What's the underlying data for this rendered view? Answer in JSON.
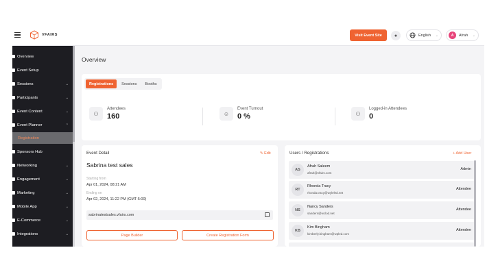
{
  "topbar": {
    "logo_text": "VFAIRS",
    "visit_button": "Visit Event Site",
    "language": "English",
    "user_initial": "A",
    "user_name": "Afrah"
  },
  "sidebar": {
    "items": [
      {
        "label": "Overview",
        "chevron": false
      },
      {
        "label": "Event Setup",
        "chevron": false
      },
      {
        "label": "Sessions",
        "chevron": true
      },
      {
        "label": "Participants",
        "chevron": true
      },
      {
        "label": "Event Content",
        "chevron": true
      },
      {
        "label": "Event Planner",
        "chevron": true
      },
      {
        "label": "Registration",
        "chevron": false,
        "active": true
      },
      {
        "label": "Sponsors Hub",
        "chevron": false
      },
      {
        "label": "Networking",
        "chevron": true
      },
      {
        "label": "Engagement",
        "chevron": true
      },
      {
        "label": "Marketing",
        "chevron": true
      },
      {
        "label": "Mobile App",
        "chevron": true
      },
      {
        "label": "E-Commerce",
        "chevron": true
      },
      {
        "label": "Integrations",
        "chevron": true
      }
    ]
  },
  "main": {
    "title": "Overview",
    "tabs": [
      "Registrations",
      "Sessions",
      "Booths"
    ],
    "stats": [
      {
        "label": "Attendees",
        "value": "160",
        "icon": "users-icon"
      },
      {
        "label": "Event Turnout",
        "value": "0 %",
        "icon": "user-icon"
      },
      {
        "label": "Logged-in Attendees",
        "value": "0",
        "icon": "users-icon"
      }
    ]
  },
  "event_detail": {
    "heading": "Event Detail",
    "edit_label": "Edit",
    "name": "Sabrina test sales",
    "starting_label": "Starting from",
    "starting_value": "Apr 01, 2024, 08:21 AM",
    "ending_label": "Ending on",
    "ending_value": "Apr 02, 2024, 11:22 PM (GMT-5:00)",
    "url": "sabrinatestsales.vfairs.com",
    "page_builder_button": "Page Builder",
    "create_form_button": "Create Registration Form"
  },
  "users": {
    "heading": "Users / Registrations",
    "add_label": "Add User",
    "rows": [
      {
        "initials": "AS",
        "name": "Afrah Saleem",
        "email": "afrah@vfairs.com",
        "role": "Admin"
      },
      {
        "initials": "RT",
        "name": "Rhonda Tracy",
        "email": "rhonda.tracy@wyleled.net",
        "role": "Attendee"
      },
      {
        "initials": "NS",
        "name": "Nancy Sanders",
        "email": "sanders@wclod.net",
        "role": "Attendee"
      },
      {
        "initials": "KB",
        "name": "Kim Bingham",
        "email": "kimberly.bingham@wpled.com",
        "role": "Attendee"
      }
    ]
  },
  "colors": {
    "accent": "#ef6331",
    "sidebar_bg": "#1d1d22"
  }
}
